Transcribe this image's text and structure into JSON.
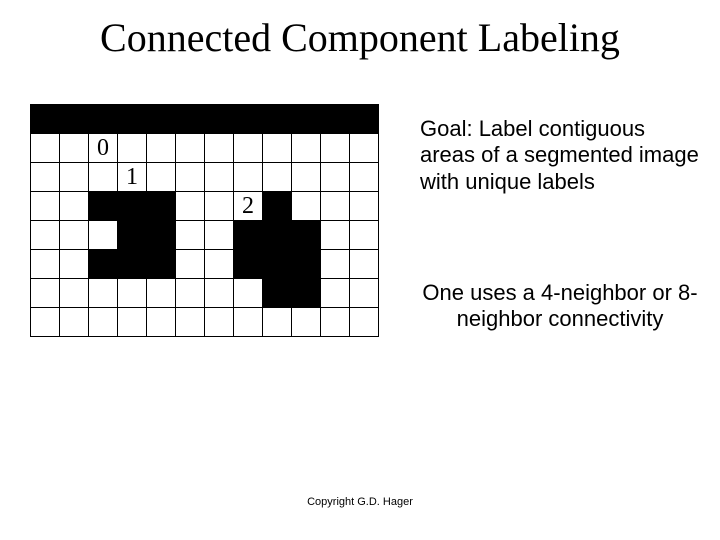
{
  "title": "Connected Component  Labeling",
  "goal_text": "Goal: Label contiguous areas of a segmented image with unique labels",
  "connectivity_text": "One uses a 4-neighbor or 8-neighbor connectivity",
  "copyright": "Copyright G.D. Hager",
  "grid": {
    "cols": 12,
    "rows": 8,
    "labels": {
      "0": {
        "row": 1,
        "col": 2
      },
      "1": {
        "row": 2,
        "col": 3
      },
      "2": {
        "row": 3,
        "col": 7
      }
    },
    "cells": [
      [
        "b",
        "b",
        "b",
        "b",
        "b",
        "b",
        "b",
        "b",
        "b",
        "b",
        "b",
        "b"
      ],
      [
        "w",
        "w",
        "0",
        "w",
        "w",
        "w",
        "w",
        "w",
        "w",
        "w",
        "w",
        "w"
      ],
      [
        "w",
        "w",
        "w",
        "1",
        "w",
        "w",
        "w",
        "w",
        "w",
        "w",
        "w",
        "w"
      ],
      [
        "w",
        "w",
        "b",
        "b",
        "b",
        "w",
        "w",
        "2",
        "b",
        "w",
        "w",
        "w"
      ],
      [
        "w",
        "w",
        "w",
        "b",
        "b",
        "w",
        "w",
        "b",
        "b",
        "b",
        "w",
        "w"
      ],
      [
        "w",
        "w",
        "b",
        "b",
        "b",
        "w",
        "w",
        "b",
        "b",
        "b",
        "w",
        "w"
      ],
      [
        "w",
        "w",
        "w",
        "w",
        "w",
        "w",
        "w",
        "w",
        "b",
        "b",
        "w",
        "w"
      ],
      [
        "w",
        "w",
        "w",
        "w",
        "w",
        "w",
        "w",
        "w",
        "w",
        "w",
        "w",
        "w"
      ]
    ]
  }
}
